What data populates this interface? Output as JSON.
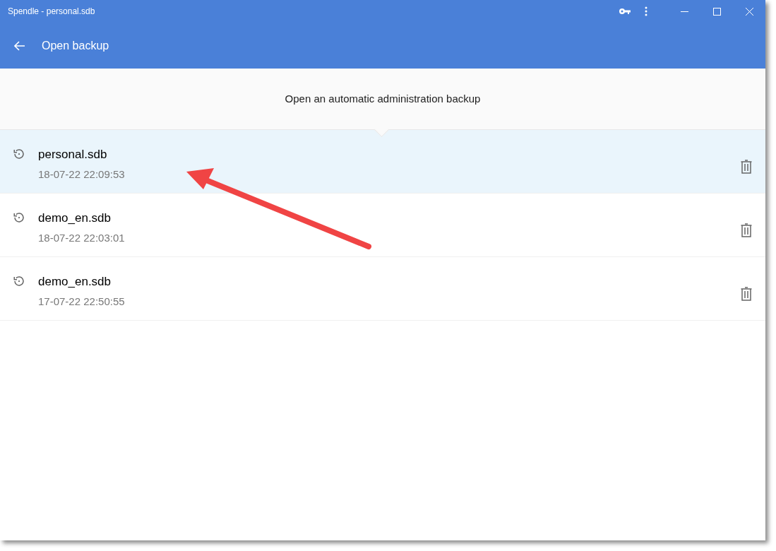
{
  "window": {
    "title": "Spendle - personal.sdb"
  },
  "header": {
    "title": "Open backup"
  },
  "subheader": "Open an automatic administration backup",
  "backups": [
    {
      "name": "personal.sdb",
      "date": "18-07-22 22:09:53",
      "selected": true
    },
    {
      "name": "demo_en.sdb",
      "date": "18-07-22 22:03:01",
      "selected": false
    },
    {
      "name": "demo_en.sdb",
      "date": "17-07-22 22:50:55",
      "selected": false
    }
  ]
}
